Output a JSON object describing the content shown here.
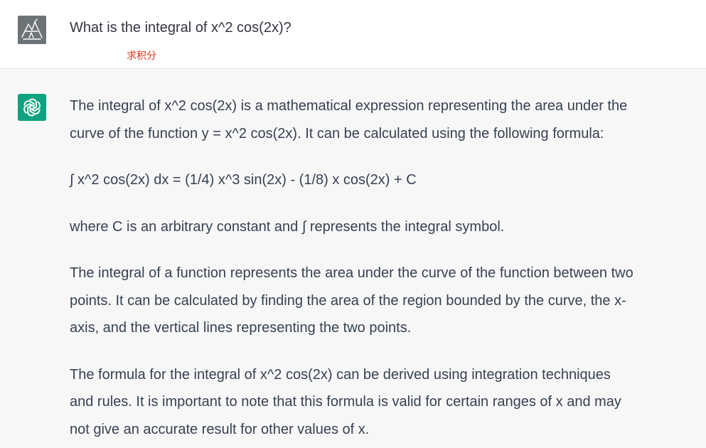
{
  "user": {
    "avatar_icon": "user-avatar-sketch-icon",
    "message": "What is the integral of x^2 cos(2x)?",
    "annotation": "求积分"
  },
  "assistant": {
    "avatar_icon": "openai-logo-icon",
    "paragraphs": [
      {
        "lines": [
          "The integral of x^2 cos(2x) is a mathematical expression representing the area under the",
          "curve of the function y = x^2 cos(2x). It can be calculated using the following formula:"
        ]
      },
      {
        "lines": [
          "∫ x^2 cos(2x) dx = (1/4) x^3 sin(2x) - (1/8) x cos(2x) + C"
        ]
      },
      {
        "lines": [
          "where C is an arbitrary constant and ∫ represents the integral symbol."
        ]
      },
      {
        "lines": [
          "The integral of a function represents the area under the curve of the function between two",
          "points. It can be calculated by finding the area of the region bounded by the curve, the x-",
          "axis, and the vertical lines representing the two points."
        ]
      },
      {
        "lines": [
          "The formula for the integral of x^2 cos(2x) can be derived using integration techniques",
          "and rules. It is important to note that this formula is valid for certain ranges of x and may",
          "not give an accurate result for other values of x."
        ]
      }
    ]
  },
  "colors": {
    "user_bg": "#ffffff",
    "assistant_bg": "#f7f7f8",
    "assistant_avatar": "#10a37f",
    "user_avatar": "#6c7478",
    "annotation": "#e0301e",
    "text": "#374151"
  }
}
